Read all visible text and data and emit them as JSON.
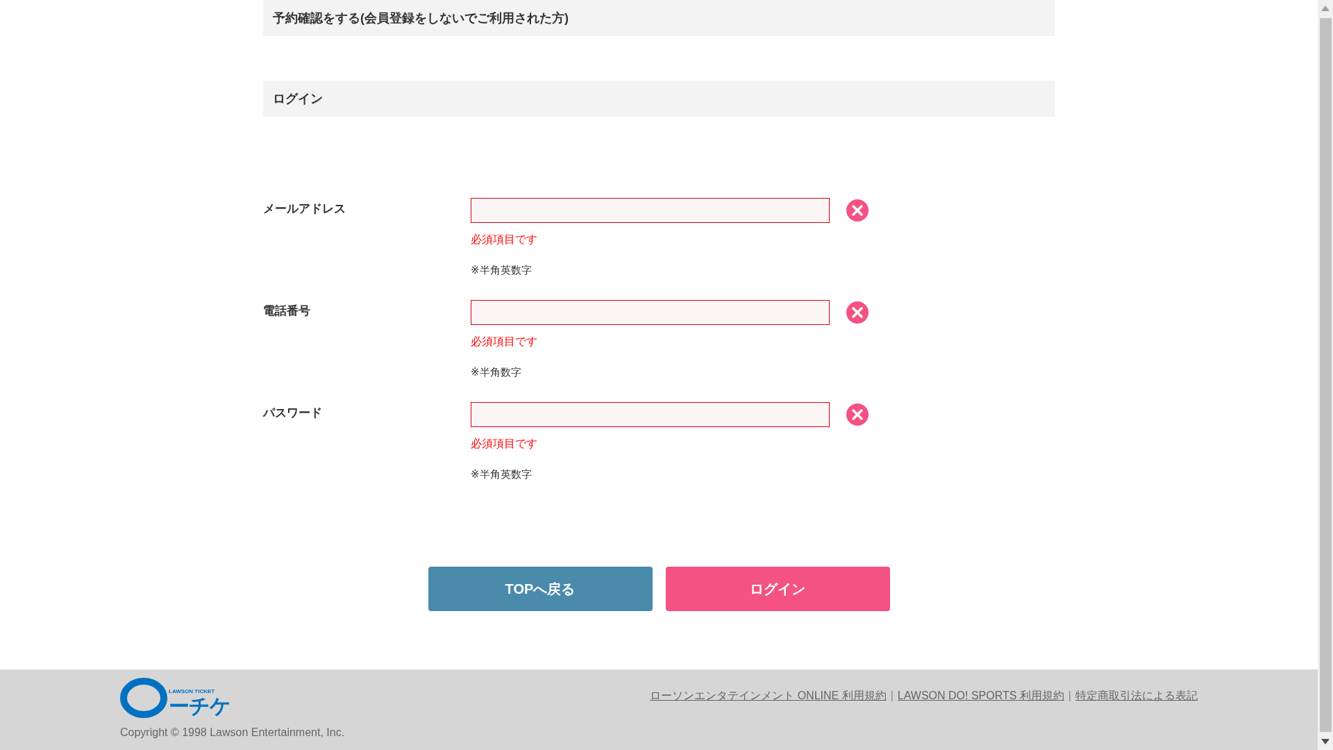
{
  "sections": [
    {
      "title": "予約確認をする(会員登録をしないでご利用された方)"
    },
    {
      "title": "ログイン"
    }
  ],
  "fields": [
    {
      "label": "メールアドレス",
      "invalid": true,
      "error": "必須項目です",
      "hint": "※半角英数字"
    },
    {
      "label": "電話番号",
      "invalid": true,
      "error": "必須項目です",
      "hint": "※半角数字"
    },
    {
      "label": "パスワード",
      "invalid": true,
      "error": "必須項目です",
      "hint": "※半角英数字"
    }
  ],
  "buttons": [
    {
      "label": "TOPへ戻る",
      "kind": "back"
    },
    {
      "label": "ログイン",
      "kind": "submit"
    }
  ],
  "footer": {
    "logo": {
      "tagline": "LAWSON TICKET",
      "name": "ーチケ"
    },
    "copyright": "Copyright © 1998 Lawson Entertainment, Inc.",
    "links": [
      "ローソンエンタテインメント ONLINE 利用規約",
      "LAWSON DO! SPORTS 利用規約",
      "特定商取引法による表記"
    ],
    "separator": "|"
  }
}
